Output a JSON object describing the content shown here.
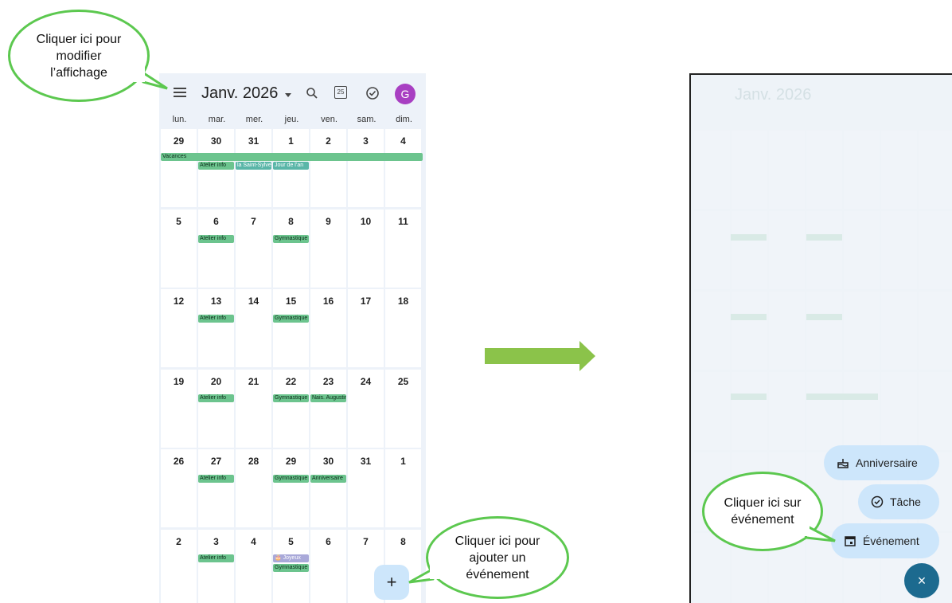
{
  "callouts": {
    "top": "Cliquer ici pour\nmodifier\nl’affichage",
    "add": "Cliquer ici pour\najouter un\névénement",
    "event": "Cliquer ici sur\névénement"
  },
  "calendar": {
    "month_label": "Janv. 2026",
    "avatar_letter": "G",
    "today_icon_text": "25",
    "weekdays": [
      "lun.",
      "mar.",
      "mer.",
      "jeu.",
      "ven.",
      "sam.",
      "dim."
    ],
    "weeks": [
      [
        "29",
        "30",
        "31",
        "1",
        "2",
        "3",
        "4"
      ],
      [
        "5",
        "6",
        "7",
        "8",
        "9",
        "10",
        "11"
      ],
      [
        "12",
        "13",
        "14",
        "15",
        "16",
        "17",
        "18"
      ],
      [
        "19",
        "20",
        "21",
        "22",
        "23",
        "24",
        "25"
      ],
      [
        "26",
        "27",
        "28",
        "29",
        "30",
        "31",
        "1"
      ],
      [
        "2",
        "3",
        "4",
        "5",
        "6",
        "7",
        "8"
      ]
    ],
    "vacances_label": "Vacances",
    "events": {
      "atelier": "Atelier info",
      "saint_sylvestre": "la Saint-Sylvestre",
      "jour_an": "Jour de l’an",
      "gym": "Gymnastique",
      "nais": "Nais. Augustin",
      "anniv": "Anniversaire",
      "joyeux": "🎂 Joyeux"
    },
    "fab_label": "+"
  },
  "right_panel": {
    "month_label": "Janv. 2026",
    "menu": {
      "anniversaire": "Anniversaire",
      "tache": "Tâche",
      "evenement": "Événement"
    },
    "close_label": "×"
  },
  "colors": {
    "accent_green": "#5cc84f",
    "event_green": "#6cc48e",
    "fab_blue": "#cde6fb",
    "close_blue": "#1c6a8f",
    "avatar_purple": "#a83fc2",
    "arrow_green": "#8bc34a"
  },
  "icons": {
    "menu": "hamburger-menu-icon",
    "search": "search-icon",
    "today": "calendar-today-icon",
    "tasks": "check-circle-icon",
    "cake": "cake-icon",
    "task": "check-circle-icon",
    "event": "calendar-event-icon"
  }
}
